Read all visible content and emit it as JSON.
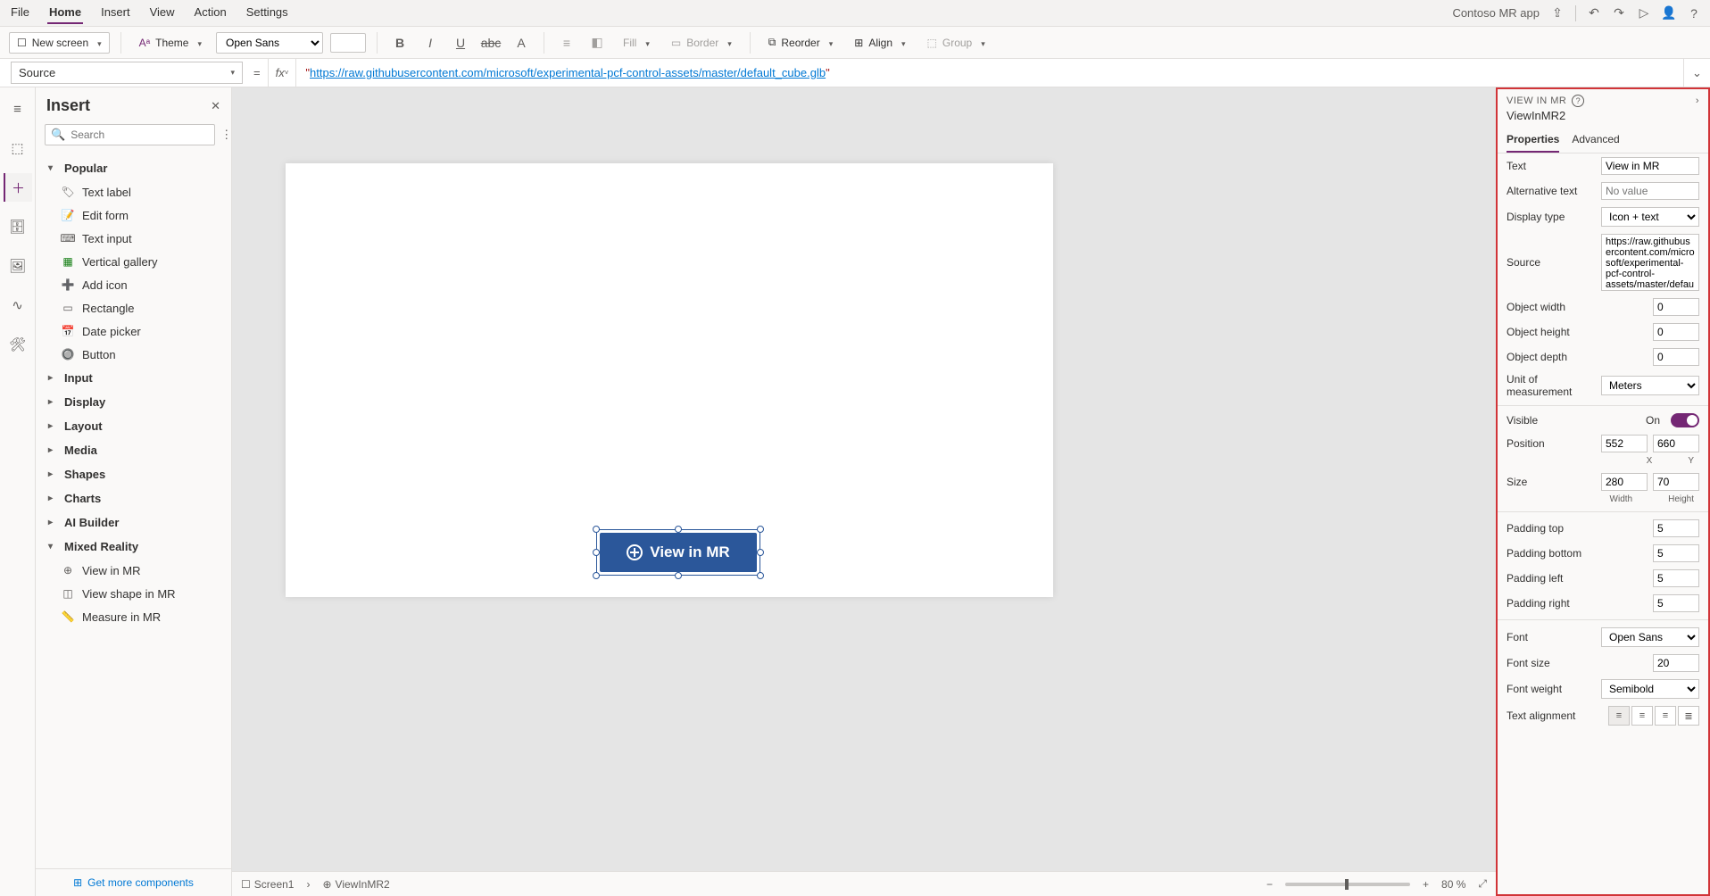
{
  "app_name": "Contoso MR app",
  "menu": {
    "file": "File",
    "home": "Home",
    "insert": "Insert",
    "view": "View",
    "action": "Action",
    "settings": "Settings"
  },
  "ribbon": {
    "new_screen": "New screen",
    "theme": "Theme",
    "font": "Open Sans",
    "fill": "Fill",
    "border": "Border",
    "reorder": "Reorder",
    "align": "Align",
    "group": "Group"
  },
  "formula": {
    "property": "Source",
    "value": "https://raw.githubusercontent.com/microsoft/experimental-pcf-control-assets/master/default_cube.glb"
  },
  "insert": {
    "title": "Insert",
    "search_ph": "Search",
    "popular": "Popular",
    "items": [
      "Text label",
      "Edit form",
      "Text input",
      "Vertical gallery",
      "Add icon",
      "Rectangle",
      "Date picker",
      "Button"
    ],
    "groups": [
      "Input",
      "Display",
      "Layout",
      "Media",
      "Shapes",
      "Charts",
      "AI Builder",
      "Mixed Reality"
    ],
    "mr_items": [
      "View in MR",
      "View shape in MR",
      "Measure in MR"
    ],
    "footer": "Get more components"
  },
  "canvas": {
    "screen": "Screen1",
    "control": "ViewInMR2",
    "button_text": "View in MR",
    "zoom": "80 %"
  },
  "props": {
    "header": "VIEW IN MR",
    "name": "ViewInMR2",
    "tabs": {
      "properties": "Properties",
      "advanced": "Advanced"
    },
    "text_label": "Text",
    "text_val": "View in MR",
    "alt_label": "Alternative text",
    "alt_ph": "No value",
    "disp_label": "Display type",
    "disp_val": "Icon + text",
    "src_label": "Source",
    "src_val": "https://raw.githubusercontent.com/microsoft/experimental-pcf-control-assets/master/default_",
    "ow_label": "Object width",
    "ow": "0",
    "oh_label": "Object height",
    "oh": "0",
    "od_label": "Object depth",
    "od": "0",
    "unit_label": "Unit of measurement",
    "unit": "Meters",
    "vis_label": "Visible",
    "vis_state": "On",
    "pos_label": "Position",
    "pos_x": "552",
    "pos_y": "660",
    "x": "X",
    "y": "Y",
    "size_label": "Size",
    "size_w": "280",
    "size_h": "70",
    "w": "Width",
    "h": "Height",
    "pt_label": "Padding top",
    "pt": "5",
    "pb_label": "Padding bottom",
    "pb": "5",
    "pl_label": "Padding left",
    "pl": "5",
    "pr_label": "Padding right",
    "pr": "5",
    "font_label": "Font",
    "font": "Open Sans",
    "fs_label": "Font size",
    "fs": "20",
    "fw_label": "Font weight",
    "fw": "Semibold",
    "ta_label": "Text alignment"
  }
}
